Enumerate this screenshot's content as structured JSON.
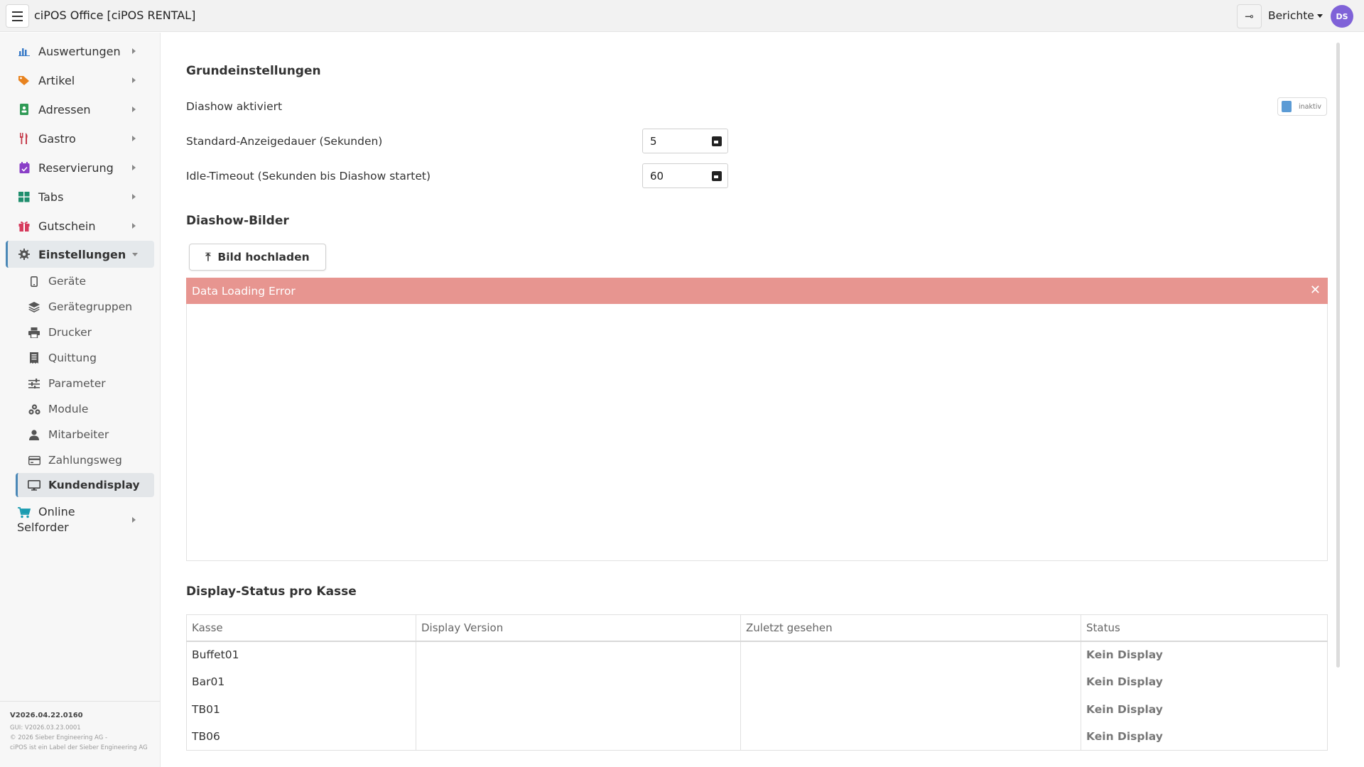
{
  "app": {
    "title": "ciPOS Office [ciPOS RENTAL]",
    "reports_label": "Berichte",
    "avatar_initials": "DS"
  },
  "sidebar": {
    "items": [
      {
        "label": "Auswertungen",
        "icon": "bar-chart-icon",
        "color": "#3a7bc8"
      },
      {
        "label": "Artikel",
        "icon": "tags-icon",
        "color": "#e8831f"
      },
      {
        "label": "Adressen",
        "icon": "address-book-icon",
        "color": "#2f9a55"
      },
      {
        "label": "Gastro",
        "icon": "utensils-icon",
        "color": "#c43a4a"
      },
      {
        "label": "Reservierung",
        "icon": "calendar-check-icon",
        "color": "#8a3fc7"
      },
      {
        "label": "Tabs",
        "icon": "grid-icon",
        "color": "#1f8e6d"
      },
      {
        "label": "Gutschein",
        "icon": "gift-icon",
        "color": "#d63a5c"
      },
      {
        "label": "Einstellungen",
        "icon": "gear-icon",
        "color": "#555555"
      }
    ],
    "sub_items": [
      {
        "label": "Geräte",
        "icon": "mobile-icon"
      },
      {
        "label": "Gerätegruppen",
        "icon": "layers-icon"
      },
      {
        "label": "Drucker",
        "icon": "printer-icon"
      },
      {
        "label": "Quittung",
        "icon": "receipt-icon"
      },
      {
        "label": "Parameter",
        "icon": "sliders-icon"
      },
      {
        "label": "Module",
        "icon": "cubes-icon"
      },
      {
        "label": "Mitarbeiter",
        "icon": "user-icon"
      },
      {
        "label": "Zahlungsweg",
        "icon": "credit-card-icon"
      },
      {
        "label": "Kundendisplay",
        "icon": "monitor-icon"
      }
    ],
    "online_line1": "Online",
    "online_line2": "Selforder",
    "footer": {
      "version": "V2026.04.22.0160",
      "gui": "GUI: V2026.03.23.0001",
      "copyright": "© 2026 Sieber Engineering AG -",
      "label": "ciPOS ist ein Label der Sieber Engineering AG"
    }
  },
  "basic": {
    "heading": "Grundeinstellungen",
    "slideshow_label": "Diashow aktiviert",
    "toggle_text": "inaktiv",
    "duration_label": "Standard-Anzeigedauer (Sekunden)",
    "duration_value": "5",
    "idle_label": "Idle-Timeout (Sekunden bis Diashow startet)",
    "idle_value": "60"
  },
  "images": {
    "heading": "Diashow-Bilder",
    "upload_label": "Bild hochladen",
    "error_text": "Data Loading Error"
  },
  "status": {
    "heading": "Display-Status pro Kasse",
    "columns": [
      "Kasse",
      "Display Version",
      "Zuletzt gesehen",
      "Status"
    ],
    "rows": [
      {
        "kasse": "Buffet01",
        "version": "",
        "seen": "",
        "status": "Kein Display"
      },
      {
        "kasse": "Bar01",
        "version": "",
        "seen": "",
        "status": "Kein Display"
      },
      {
        "kasse": "TB01",
        "version": "",
        "seen": "",
        "status": "Kein Display"
      },
      {
        "kasse": "TB06",
        "version": "",
        "seen": "",
        "status": "Kein Display"
      }
    ]
  }
}
